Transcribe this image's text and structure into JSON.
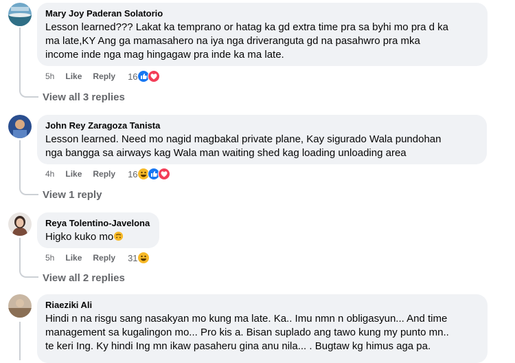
{
  "comments": [
    {
      "author": "Mary Joy Paderan Solatorio",
      "lines": [
        "Lesson learned??? Lakat ka temprano or hatag ka gd extra time pra sa byhi mo pra d ka",
        "ma late,KY Ang ga mamasahero na iya nga driveranguta gd na pasahwro pra mka",
        "income inde nga mag hingagaw pra inde ka ma late."
      ],
      "time": "5h",
      "like": "Like",
      "reply": "Reply",
      "reaction_count": "16",
      "reactions": [
        "like-icon",
        "love-icon"
      ],
      "view_replies": "View all 3 replies"
    },
    {
      "author": "John Rey Zaragoza Tanista",
      "lines": [
        "Lesson learned. Need mo nagid magbakal private plane, Kay sigurado Wala pundohan",
        "nga bangga sa airways kag Wala man waiting shed kag loading unloading area"
      ],
      "time": "4h",
      "like": "Like",
      "reply": "Reply",
      "reaction_count": "16",
      "reactions": [
        "haha-icon",
        "like-icon",
        "love-icon"
      ],
      "view_replies": "View 1 reply"
    },
    {
      "author": "Reya Tolentino-Javelona",
      "lines": [
        "Higko kuko mo"
      ],
      "time": "5h",
      "like": "Like",
      "reply": "Reply",
      "reaction_count": "31",
      "reactions": [
        "haha-icon"
      ],
      "view_replies": "View all 2 replies"
    },
    {
      "author": "Riaeziki Ali",
      "lines": [
        "Hindi n na risgu sang nasakyan mo kung ma late. Ka.. Imu nmn n obligasyun... And time",
        "management sa kugalingon mo... Pro kis a. Bisan suplado ang tawo kung my punto mn..",
        "te keri Ing. Ky hindi Ing mn ikaw pasaheru gina anu nila... . Bugtaw kg himus aga pa."
      ]
    }
  ],
  "colors": {
    "bubble": "#f0f2f5",
    "meta": "#65676b",
    "like": "#1877f2",
    "love": "#f33e58",
    "haha": "#f7b928"
  }
}
